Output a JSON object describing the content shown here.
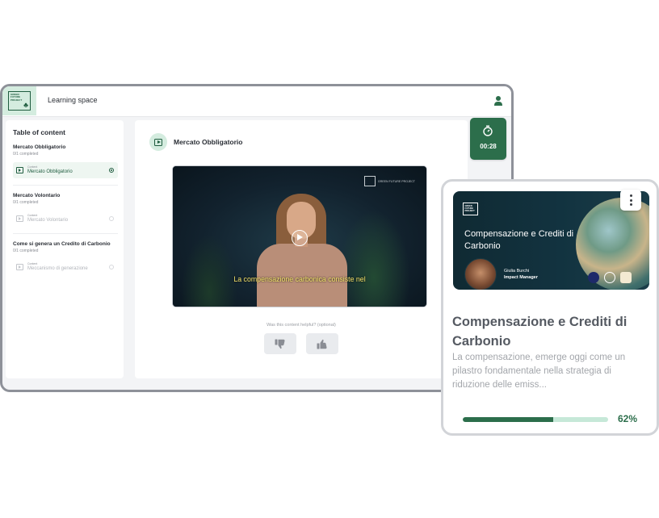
{
  "app": {
    "title": "Learning space",
    "logo_text": "GREEN FUTURE PROJECT"
  },
  "sidebar": {
    "title": "Table of content",
    "sections": [
      {
        "title": "Mercato Obbligatorio",
        "progress": "0/1 completed",
        "item": {
          "tag": "Content",
          "label": "Mercato Obbligatorio",
          "active": true
        }
      },
      {
        "title": "Mercato Volontario",
        "progress": "0/1 completed",
        "item": {
          "tag": "Content",
          "label": "Mercato Volontario",
          "active": false
        }
      },
      {
        "title": "Come si genera un Credito di Carbonio",
        "progress": "0/1 completed",
        "item": {
          "tag": "Content",
          "label": "Meccanismo di generazione",
          "active": false
        }
      }
    ]
  },
  "content": {
    "title": "Mercato Obbligatorio",
    "video": {
      "watermark": "GREEN FUTURE PROJECT",
      "caption": "La compensazione carbonica consiste nel"
    },
    "helpful_prompt": "Was this content helpful? (optional)"
  },
  "timer": {
    "value": "00:28"
  },
  "card": {
    "thumbnail": {
      "logo_text": "GREEN FUTURE PROJECT",
      "title": "Compensazione e Crediti di Carbonio",
      "person_name": "Giulia Burchi",
      "person_role": "Impact Manager"
    },
    "title": "Compensazione e Crediti di Carbonio",
    "description": "La compensazione, emerge oggi come un pilastro fondamentale nella strategia di riduzione delle emiss...",
    "progress": 0.62,
    "progress_label": "62%"
  },
  "colors": {
    "brand_green": "#2c6e4b",
    "brand_green_light": "#d4ecdf",
    "progress_track": "#c6e8d8",
    "caption_yellow": "#f4e36b"
  },
  "icons": [
    "user-icon",
    "play-icon",
    "thumbs-down-icon",
    "thumbs-up-icon",
    "timer-icon",
    "more-vertical-icon"
  ]
}
